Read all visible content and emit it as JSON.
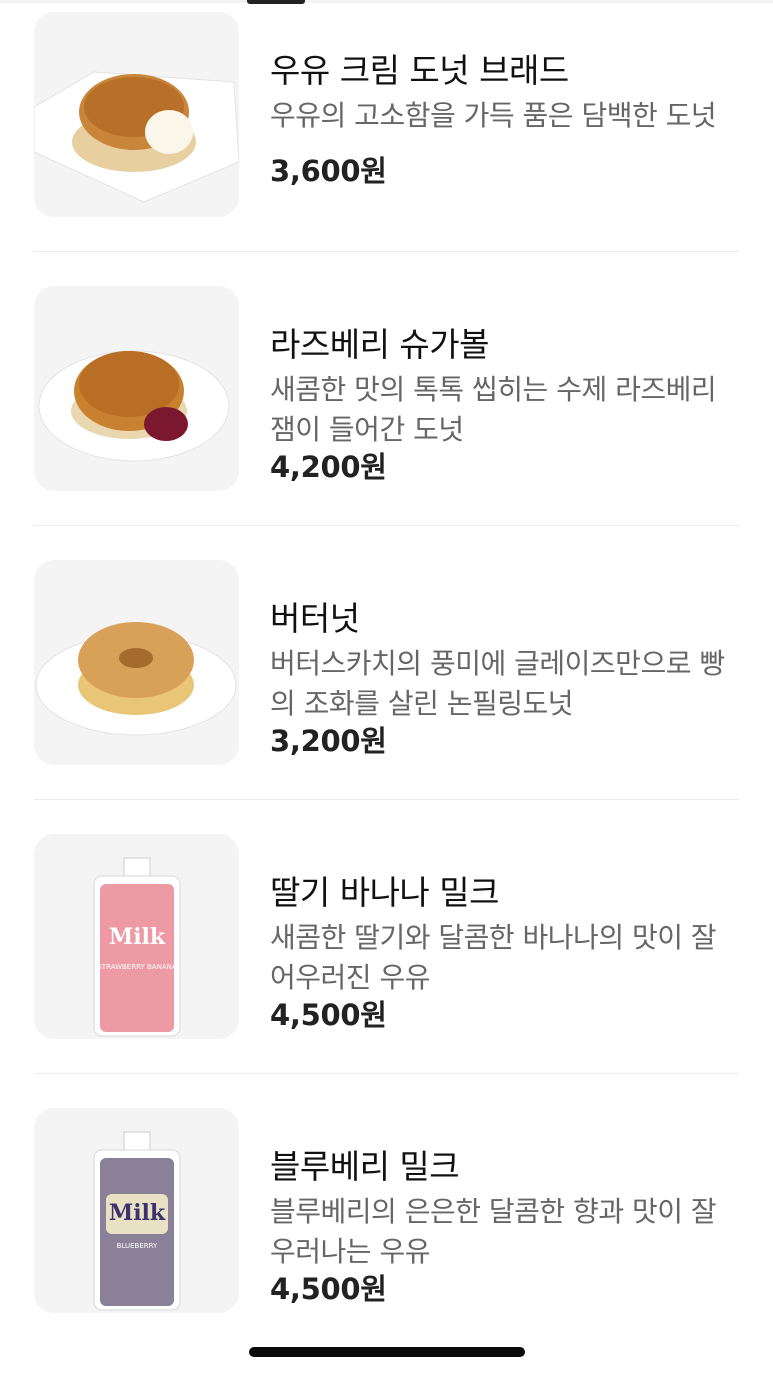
{
  "products": [
    {
      "name": "우유 크림 도넛 브래드",
      "description": "우유의 고소함을 가득 품은 담백한 도넛",
      "price": "3,600원",
      "image": "milk-cream-donut"
    },
    {
      "name": "라즈베리 슈가볼",
      "description": "새콤한 맛의 톡톡 씹히는 수제 라즈베리 잼이 들어간 도넛",
      "price": "4,200원",
      "image": "raspberry-sugar-ball"
    },
    {
      "name": "버터넛",
      "description": "버터스카치의 풍미에 글레이즈만으로 빵의 조화를 살린 논필링도넛",
      "price": "3,200원",
      "image": "butternut-donut"
    },
    {
      "name": "딸기 바나나 밀크",
      "description": "새콤한 딸기와 달콤한 바나나의 맛이 잘 어우러진 우유",
      "price": "4,500원",
      "image": "strawberry-banana-milk-pouch",
      "pack_label": "Milk",
      "pack_flavor": "STRAWBERRY BANANA",
      "pack_color": "#ee9aa4"
    },
    {
      "name": "블루베리 밀크",
      "description": "블루베리의 은은한 달콤한 향과 맛이 잘 우러나는 우유",
      "price": "4,500원",
      "image": "blueberry-milk-pouch",
      "pack_label": "Milk",
      "pack_flavor": "BLUEBERRY",
      "pack_color": "#8a8098"
    }
  ]
}
